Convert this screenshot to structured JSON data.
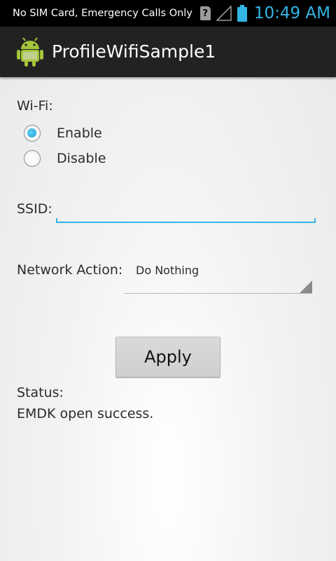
{
  "status_bar": {
    "carrier_text": "No SIM Card, Emergency Calls Only",
    "sim_icon_glyph": "?",
    "time": "10:49 AM",
    "accent_color": "#33b5e5",
    "icons": [
      "sim-missing-icon",
      "signal-icon",
      "battery-icon"
    ]
  },
  "action_bar": {
    "title": "ProfileWifiSample1",
    "icon": "android-app-icon"
  },
  "form": {
    "wifi_label": "Wi-Fi:",
    "wifi_options": [
      {
        "label": "Enable",
        "checked": true
      },
      {
        "label": "Disable",
        "checked": false
      }
    ],
    "ssid_label": "SSID:",
    "ssid_value": "",
    "network_action_label": "Network Action:",
    "network_action_selected": "Do Nothing",
    "apply_label": "Apply"
  },
  "status": {
    "label": "Status:",
    "message": "EMDK open success."
  }
}
